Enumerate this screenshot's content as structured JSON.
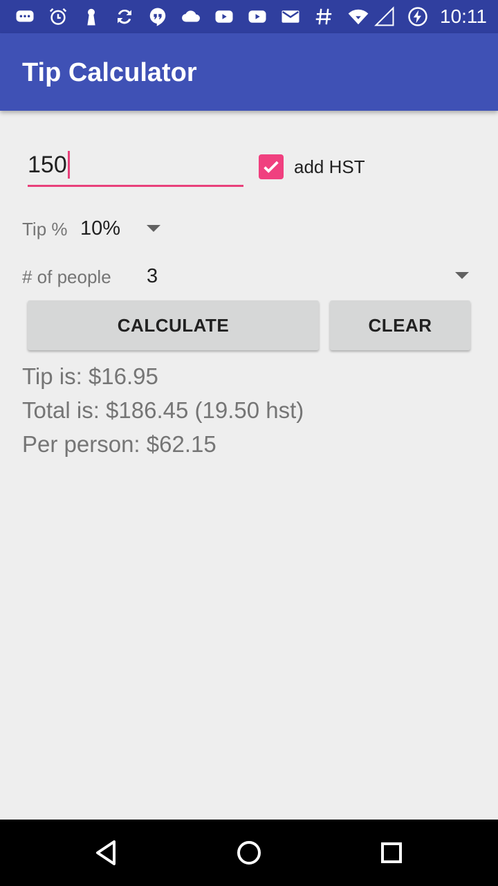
{
  "status_bar": {
    "icons": [
      "messenger-icon",
      "alarm-icon",
      "keyhole-icon",
      "sync-icon",
      "hangouts-icon",
      "cloud-icon",
      "youtube-icon",
      "youtube-icon",
      "gmail-icon",
      "hash-icon",
      "wifi-icon",
      "signal-icon",
      "battery-charging-icon"
    ],
    "time": "10:11"
  },
  "app_bar": {
    "title": "Tip Calculator"
  },
  "form": {
    "amount_value": "150",
    "add_hst": {
      "label": "add HST",
      "checked": true
    },
    "tip": {
      "label": "Tip %",
      "selected": "10%"
    },
    "people": {
      "label": "# of people",
      "selected": "3"
    }
  },
  "buttons": {
    "calculate": "CALCULATE",
    "clear": "CLEAR"
  },
  "results": {
    "tip": "Tip is: $16.95",
    "total": "Total is: $186.45 (19.50 hst)",
    "per_person": "Per person: $62.15"
  },
  "nav_bar": {
    "icons": [
      "back-icon",
      "home-icon",
      "recents-icon"
    ]
  },
  "colors": {
    "primary": "#3f51b5",
    "primary_dark": "#303f9f",
    "accent": "#f0407f",
    "background": "#eeeeee",
    "button": "#d6d7d7"
  }
}
